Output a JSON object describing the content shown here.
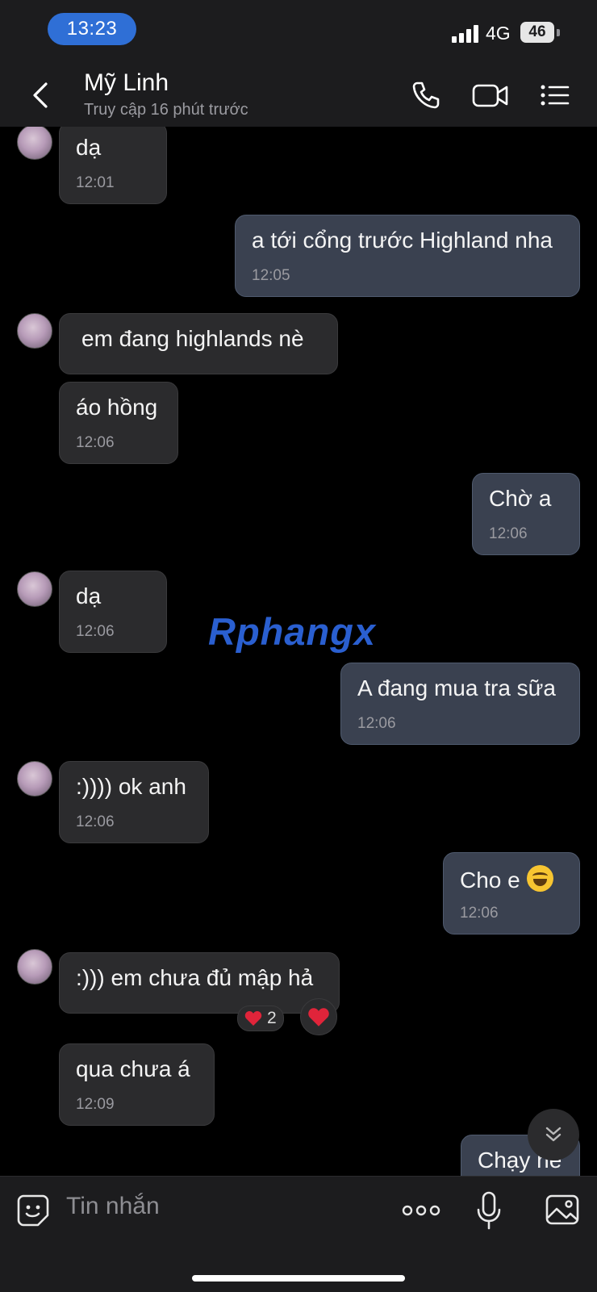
{
  "status_bar": {
    "time": "13:23",
    "network": "4G",
    "battery": "46"
  },
  "header": {
    "name": "Mỹ Linh",
    "status": "Truy cập 16 phút trước"
  },
  "messages": [
    {
      "dir": "in",
      "text": "dạ",
      "time": "12:01"
    },
    {
      "dir": "out",
      "text": "a tới cổng trước Highland nha",
      "time": "12:05"
    },
    {
      "dir": "in",
      "text": "em đang highlands nè",
      "time": ""
    },
    {
      "dir": "in",
      "text": "áo hồng",
      "time": "12:06"
    },
    {
      "dir": "out",
      "text": "Chờ a",
      "time": "12:06"
    },
    {
      "dir": "in",
      "text": "dạ",
      "time": "12:06"
    },
    {
      "dir": "out",
      "text": "A đang mua tra sữa",
      "time": "12:06"
    },
    {
      "dir": "in",
      "text": ":)))) ok anh",
      "time": "12:06"
    },
    {
      "dir": "out",
      "text": "Cho e",
      "emoji": "face-with-tears-of-joy",
      "time": "12:06"
    },
    {
      "dir": "in",
      "text": ":))) em chưa đủ mập hả",
      "time": "",
      "reaction": {
        "emoji": "heart",
        "count": "2"
      }
    },
    {
      "dir": "in",
      "text": "qua chưa á",
      "time": "12:09"
    },
    {
      "dir": "out",
      "text": "Chạy ne",
      "time": ""
    }
  ],
  "watermark": "Rphangx",
  "input": {
    "placeholder": "Tin nhắn"
  },
  "colors": {
    "accent_pill": "#2f6fd6",
    "incoming_bubble": "#2b2b2d",
    "outgoing_bubble": "#3a4150",
    "heart": "#e0243a"
  }
}
